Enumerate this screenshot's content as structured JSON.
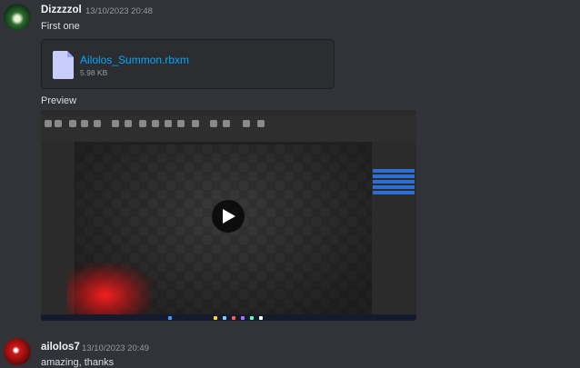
{
  "messages": [
    {
      "author": "Dizzzzol",
      "timestamp": "13/10/2023 20:48",
      "text": "First one",
      "attachment": {
        "filename": "Ailolos_Summon.rbxm",
        "size": "5.98 KB"
      },
      "preview_label": "Preview",
      "video": {
        "type": "embedded-video",
        "control": "play-icon"
      }
    },
    {
      "author": "ailolos7",
      "timestamp": "13/10/2023 20:49",
      "text": "amazing, thanks"
    }
  ],
  "colors": {
    "background": "#313338",
    "attachment_bg": "#2b2d31",
    "link": "#00a8fc",
    "muted": "#949ba4",
    "author": "#f2f3f5"
  }
}
